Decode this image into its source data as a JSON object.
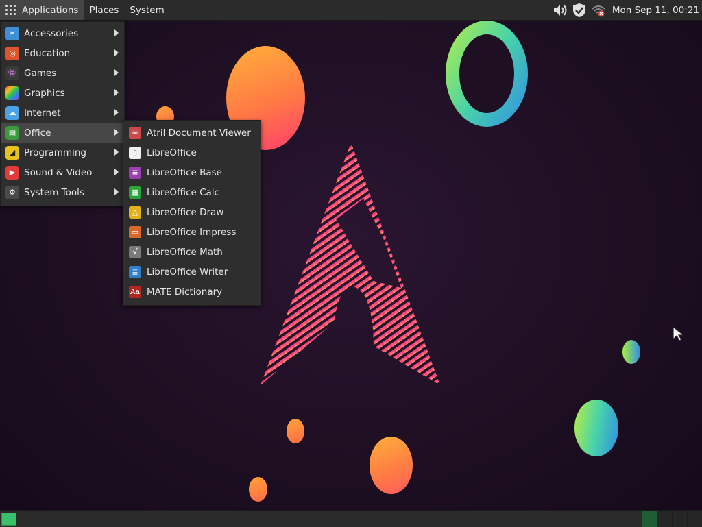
{
  "top_panel": {
    "applications_label": "Applications",
    "places_label": "Places",
    "system_label": "System",
    "clock": "Mon Sep 11, 00:21",
    "tray_icons": [
      "volume-icon",
      "shield-icon",
      "network-disconnected-icon"
    ]
  },
  "app_menu": {
    "items": [
      {
        "label": "Accessories",
        "icon": "accessories-icon",
        "color": "#3d8fd6"
      },
      {
        "label": "Education",
        "icon": "education-icon",
        "color": "#e0542b"
      },
      {
        "label": "Games",
        "icon": "games-icon",
        "color": "#3a3a3a"
      },
      {
        "label": "Graphics",
        "icon": "graphics-icon",
        "color": "#b13ad6"
      },
      {
        "label": "Internet",
        "icon": "internet-icon",
        "color": "#4aa2e8"
      },
      {
        "label": "Office",
        "icon": "office-icon",
        "color": "#3b9a3b"
      },
      {
        "label": "Programming",
        "icon": "programming-icon",
        "color": "#e8c21c"
      },
      {
        "label": "Sound & Video",
        "icon": "sound-video-icon",
        "color": "#e33a3a"
      },
      {
        "label": "System Tools",
        "icon": "system-tools-icon",
        "color": "#4a4a4a"
      }
    ],
    "highlighted": "Office"
  },
  "office_submenu": {
    "items": [
      {
        "label": "Atril Document Viewer",
        "icon": "atril-icon",
        "color": "#c94a4a"
      },
      {
        "label": "LibreOffice",
        "icon": "libreoffice-icon",
        "color": "#f0f0f0"
      },
      {
        "label": "LibreOffice Base",
        "icon": "libreoffice-base-icon",
        "color": "#9b3fb3"
      },
      {
        "label": "LibreOffice Calc",
        "icon": "libreoffice-calc-icon",
        "color": "#2aa53b"
      },
      {
        "label": "LibreOffice Draw",
        "icon": "libreoffice-draw-icon",
        "color": "#e0b21c"
      },
      {
        "label": "LibreOffice Impress",
        "icon": "libreoffice-impress-icon",
        "color": "#d9682a"
      },
      {
        "label": "LibreOffice Math",
        "icon": "libreoffice-math-icon",
        "color": "#7a7a7a"
      },
      {
        "label": "LibreOffice Writer",
        "icon": "libreoffice-writer-icon",
        "color": "#2f7fc9"
      },
      {
        "label": "MATE Dictionary",
        "icon": "dictionary-icon",
        "color": "#b3261e",
        "glyph": "Aa"
      }
    ]
  },
  "colors": {
    "panel": "#2b2b2b",
    "menu": "#2e2e2e",
    "highlight": "#474747",
    "desktop": "#1e0f23"
  }
}
